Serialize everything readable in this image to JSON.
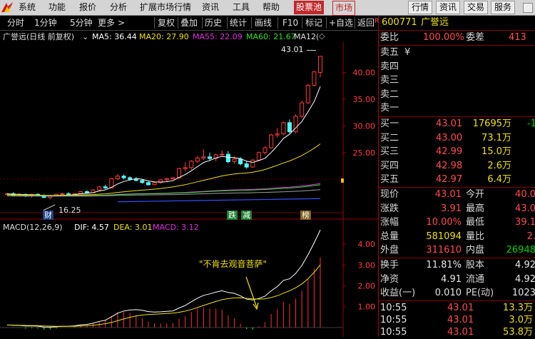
{
  "menu": {
    "items": [
      "系统",
      "功能",
      "报价",
      "分析",
      "扩展市场行情",
      "资讯",
      "工具",
      "帮助"
    ],
    "active": "股票池",
    "market": "市场",
    "right_buttons": [
      "行情",
      "资讯",
      "交易",
      "服务"
    ]
  },
  "toolbar": {
    "periods": [
      "分时",
      "1分钟",
      "5分钟",
      "更多"
    ],
    "more_arrow": ">",
    "buttons": [
      "复权",
      "叠加",
      "历史",
      "统计",
      "画线",
      "F10",
      "标记",
      "+自选",
      "返回"
    ]
  },
  "kline_header": {
    "title": "广誉远(日线 前复权)",
    "ma5": "MA5: 36.44",
    "ma20": "MA20: 27.90",
    "ma55": "MA55: 22.09",
    "ma60": "MA60: 21.67",
    "ma120": "MA12("
  },
  "price_axis": [
    "40.00",
    "35.00",
    "30.00",
    "25.00"
  ],
  "annotations": {
    "high": "43.01",
    "low": "16.25",
    "cai": "财",
    "die": "跌",
    "jian": "减",
    "bang": "榜",
    "quote": "\"不肯去观音菩萨\""
  },
  "macd_header": {
    "label": "MACD(12,26,9)",
    "dif": "DIF: 4.57",
    "dea": "DEA: 3.01",
    "macd": "MACD: 3.12"
  },
  "macd_axis": [
    "4.00",
    "3.00",
    "2.00",
    "1.00"
  ],
  "stock": {
    "r_mark": "R",
    "code": "600771",
    "name": "广誉远",
    "weibi_label": "委比",
    "weibi": "100.00%",
    "weicha_label": "委差",
    "weicha": "413"
  },
  "sell": [
    {
      "label": "卖五",
      "price": "¥",
      "vol": ""
    },
    {
      "label": "卖四",
      "price": "",
      "vol": ""
    },
    {
      "label": "卖三",
      "price": "",
      "vol": ""
    },
    {
      "label": "卖二",
      "price": "",
      "vol": ""
    },
    {
      "label": "卖一",
      "price": "",
      "vol": ""
    }
  ],
  "buy": [
    {
      "label": "买一",
      "price": "43.01",
      "vol": "17695万",
      "chg": "-1"
    },
    {
      "label": "买二",
      "price": "43.00",
      "vol": "73.1万",
      "chg": ""
    },
    {
      "label": "买三",
      "price": "42.99",
      "vol": "15.0万",
      "chg": ""
    },
    {
      "label": "买四",
      "price": "42.98",
      "vol": "2.6万",
      "chg": ""
    },
    {
      "label": "买五",
      "price": "42.97",
      "vol": "6.4万",
      "chg": ""
    }
  ],
  "stats": [
    {
      "l1": "现价",
      "v1": "43.01",
      "l2": "今开",
      "v2": "40.0",
      "c1": "red",
      "c2": "red"
    },
    {
      "l1": "涨跌",
      "v1": "3.91",
      "l2": "最高",
      "v2": "43.0",
      "c1": "red",
      "c2": "red"
    },
    {
      "l1": "涨幅",
      "v1": "10.00%",
      "l2": "最低",
      "v2": "39.1",
      "c1": "red",
      "c2": "red"
    },
    {
      "l1": "总量",
      "v1": "581094",
      "l2": "量比",
      "v2": "2.",
      "c1": "yel",
      "c2": "red"
    },
    {
      "l1": "外盘",
      "v1": "311610",
      "l2": "内盘",
      "v2": "26948",
      "c1": "red",
      "c2": "grn"
    }
  ],
  "stats2": [
    {
      "l1": "换手",
      "v1": "11.81%",
      "l2": "股本",
      "v2": "4.92"
    },
    {
      "l1": "净资",
      "v1": "4.91",
      "l2": "流通",
      "v2": "4.92"
    },
    {
      "l1": "收益(一)",
      "v1": "0.010",
      "l2": "PE(动)",
      "v2": "1023"
    }
  ],
  "ticks": [
    {
      "time": "10:55",
      "price": "43.01",
      "vol": "13.3万"
    },
    {
      "time": "10:55",
      "price": "43.01",
      "vol": "3.0万"
    },
    {
      "time": "10:55",
      "price": "43.01",
      "vol": "53.8万"
    }
  ],
  "chart_data": {
    "type": "candlestick",
    "y_ticks": [
      25,
      30,
      35,
      40
    ],
    "candles": [
      [
        17.2,
        17.5,
        16.9,
        17.3
      ],
      [
        17.3,
        17.6,
        17.0,
        17.1
      ],
      [
        17.1,
        17.4,
        16.8,
        17.2
      ],
      [
        17.2,
        17.3,
        16.7,
        16.9
      ],
      [
        16.9,
        17.3,
        16.6,
        17.2
      ],
      [
        17.2,
        17.4,
        16.9,
        17.0
      ],
      [
        17.0,
        17.2,
        16.5,
        16.6
      ],
      [
        16.6,
        17.1,
        16.25,
        16.9
      ],
      [
        16.9,
        17.3,
        16.8,
        17.2
      ],
      [
        17.2,
        17.5,
        17.0,
        17.3
      ],
      [
        17.3,
        17.6,
        17.0,
        17.1
      ],
      [
        17.1,
        17.4,
        16.9,
        17.3
      ],
      [
        17.3,
        17.8,
        17.2,
        17.7
      ],
      [
        17.7,
        18.0,
        17.4,
        17.5
      ],
      [
        17.5,
        18.2,
        17.4,
        18.0
      ],
      [
        18.0,
        18.8,
        17.9,
        18.6
      ],
      [
        18.6,
        19.0,
        18.2,
        18.4
      ],
      [
        18.4,
        20.3,
        18.3,
        20.1
      ],
      [
        20.1,
        21.0,
        19.8,
        20.6
      ],
      [
        20.6,
        20.9,
        20.0,
        20.3
      ],
      [
        20.3,
        20.6,
        19.8,
        20.0
      ],
      [
        20.0,
        20.4,
        19.6,
        19.8
      ],
      [
        19.8,
        20.0,
        19.2,
        19.4
      ],
      [
        19.4,
        19.6,
        18.8,
        19.0
      ],
      [
        19.0,
        19.5,
        18.9,
        19.4
      ],
      [
        19.4,
        20.0,
        19.2,
        19.9
      ],
      [
        19.9,
        20.3,
        19.6,
        20.1
      ],
      [
        20.1,
        20.5,
        19.9,
        20.3
      ],
      [
        20.3,
        22.2,
        20.1,
        22.0
      ],
      [
        22.0,
        23.2,
        21.5,
        22.2
      ],
      [
        22.2,
        23.6,
        21.8,
        23.4
      ],
      [
        23.4,
        24.4,
        23.0,
        24.0
      ],
      [
        24.0,
        25.6,
        23.6,
        24.2
      ],
      [
        24.2,
        25.0,
        23.5,
        23.9
      ],
      [
        23.9,
        24.8,
        23.4,
        24.6
      ],
      [
        24.6,
        25.4,
        24.3,
        24.7
      ],
      [
        24.7,
        25.3,
        23.0,
        23.3
      ],
      [
        23.3,
        24.3,
        22.9,
        23.8
      ],
      [
        23.8,
        24.2,
        22.6,
        22.9
      ],
      [
        22.9,
        23.4,
        22.0,
        22.3
      ],
      [
        22.3,
        23.8,
        22.2,
        23.6
      ],
      [
        23.6,
        25.2,
        23.4,
        25.0
      ],
      [
        25.0,
        26.2,
        24.6,
        25.9
      ],
      [
        25.9,
        28.5,
        25.7,
        28.3
      ],
      [
        28.3,
        29.6,
        27.8,
        28.5
      ],
      [
        28.5,
        30.8,
        28.3,
        30.6
      ],
      [
        30.6,
        31.2,
        28.6,
        28.9
      ],
      [
        28.9,
        32.2,
        28.6,
        31.8
      ],
      [
        31.8,
        34.7,
        31.5,
        34.3
      ],
      [
        34.3,
        37.8,
        34.1,
        37.6
      ],
      [
        37.6,
        40.3,
        37.4,
        40.1
      ],
      [
        40.0,
        43.01,
        39.1,
        43.01
      ]
    ],
    "macd": {
      "dif_end": 4.57,
      "dea_end": 3.01,
      "macd_end": 3.12
    }
  }
}
